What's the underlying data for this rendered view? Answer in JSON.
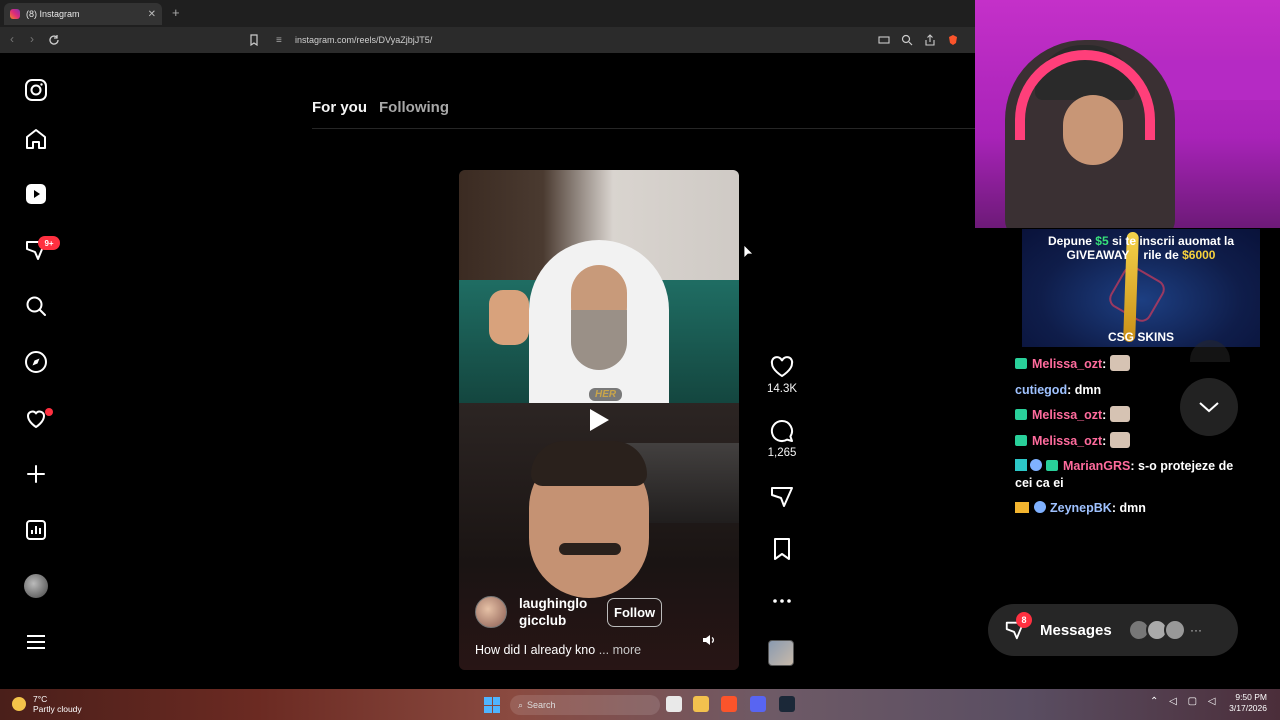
{
  "browser": {
    "tab_title": "(8) Instagram",
    "tab_close": "✕",
    "new_tab": "+",
    "url": "instagram.com/reels/DVyaZjbjJT5/"
  },
  "sidebar": {
    "notification_badge": "9+"
  },
  "feed": {
    "tabs": [
      {
        "label": "For you"
      },
      {
        "label": "Following"
      }
    ]
  },
  "reel": {
    "overlay_text": "HER",
    "author": "laughinglogicclub",
    "author_display_line1": "laughinglo",
    "author_display_line2": "gicclub",
    "follow_label": "Follow",
    "caption": "How did I already kno",
    "caption_ellipsis": "...",
    "more_label": "more"
  },
  "actions": {
    "likes": "14.3K",
    "comments": "1,265"
  },
  "stream": {
    "promo_line1_pre": "Depune ",
    "promo_amount": "$5",
    "promo_line1_post": " si te inscrii auomat la",
    "promo_line2_pre": "GIVEAWAY",
    "promo_line2_mid": "rile de ",
    "promo_prize": "$6000",
    "promo_brand": "CSG  SKINS",
    "chat": [
      {
        "user": "Melissa_ozt",
        "sep": ":",
        "text": ""
      },
      {
        "user": "cutiegod",
        "sep": ":",
        "text": " dmn"
      },
      {
        "user": "Melissa_ozt",
        "sep": ":",
        "text": ""
      },
      {
        "user": "Melissa_ozt",
        "sep": ":",
        "text": ""
      },
      {
        "user": "MarianGRS",
        "sep": ":",
        "text": " s-o protejeze de cei ca ei"
      },
      {
        "user": "ZeynepBK",
        "sep": ":",
        "text": " dmn"
      }
    ]
  },
  "messages": {
    "label": "Messages",
    "badge": "8",
    "more": "···"
  },
  "taskbar": {
    "temp": "7°C",
    "condition": "Partly cloudy",
    "search": "Search",
    "time": "9:50 PM",
    "date": "3/17/2026"
  }
}
